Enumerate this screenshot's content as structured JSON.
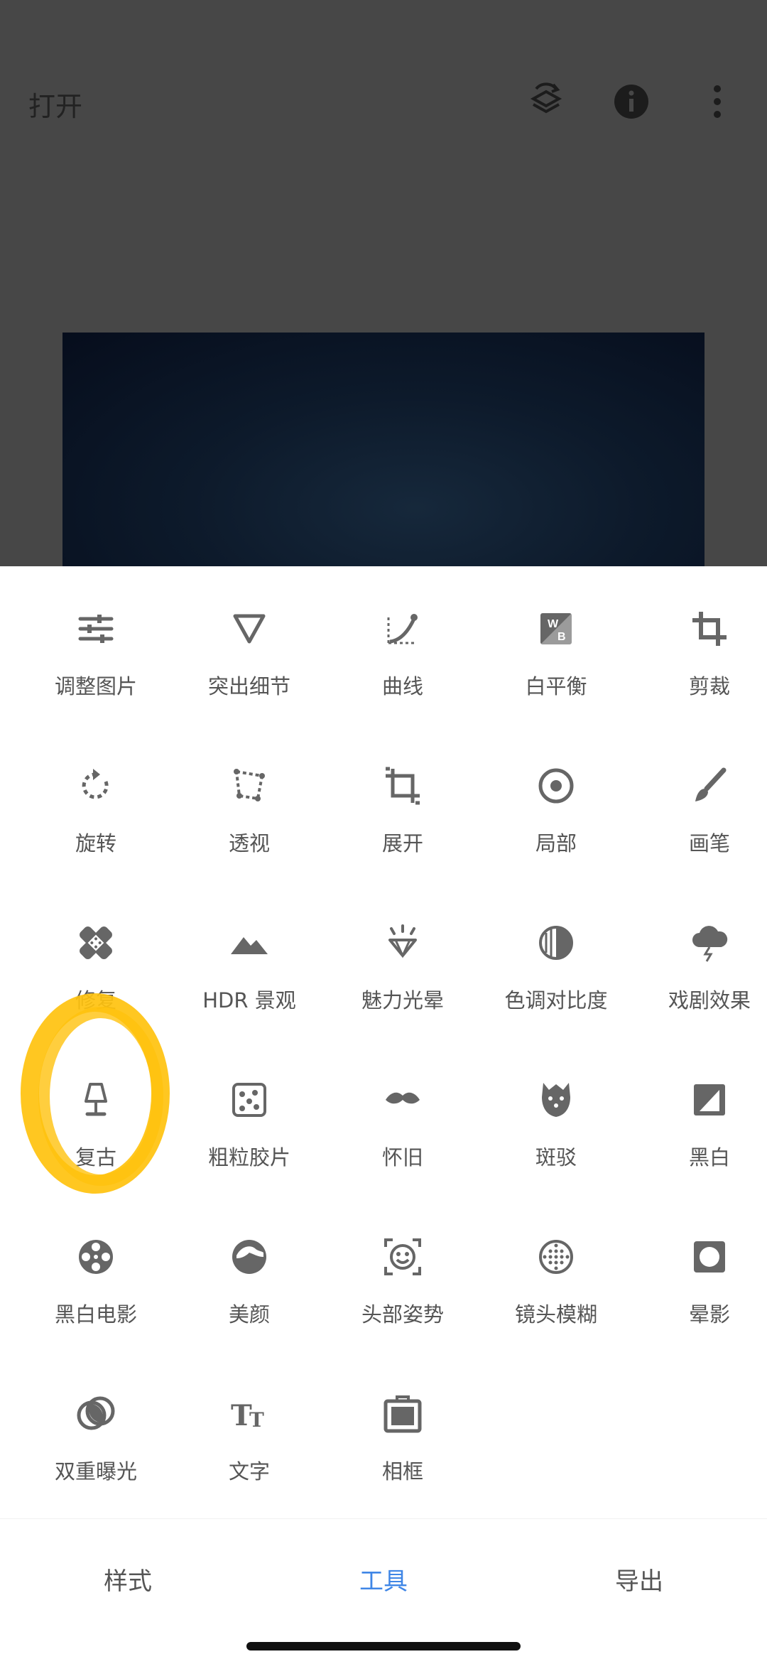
{
  "header": {
    "open_label": "打开",
    "icons": [
      "undo-stack-icon",
      "info-icon",
      "more-vert-icon"
    ]
  },
  "tools": [
    {
      "label": "调整图片",
      "icon": "tune-icon"
    },
    {
      "label": "突出细节",
      "icon": "details-icon"
    },
    {
      "label": "曲线",
      "icon": "curves-icon"
    },
    {
      "label": "白平衡",
      "icon": "white-balance-icon"
    },
    {
      "label": "剪裁",
      "icon": "crop-icon"
    },
    {
      "label": "旋转",
      "icon": "rotate-icon"
    },
    {
      "label": "透视",
      "icon": "perspective-icon"
    },
    {
      "label": "展开",
      "icon": "expand-icon"
    },
    {
      "label": "局部",
      "icon": "selective-icon"
    },
    {
      "label": "画笔",
      "icon": "brush-icon"
    },
    {
      "label": "修复",
      "icon": "healing-icon"
    },
    {
      "label": "HDR 景观",
      "icon": "hdr-icon"
    },
    {
      "label": "魅力光晕",
      "icon": "glamour-glow-icon"
    },
    {
      "label": "色调对比度",
      "icon": "tonal-contrast-icon"
    },
    {
      "label": "戏剧效果",
      "icon": "drama-icon"
    },
    {
      "label": "复古",
      "icon": "vintage-lamp-icon"
    },
    {
      "label": "粗粒胶片",
      "icon": "grainy-film-icon"
    },
    {
      "label": "怀旧",
      "icon": "mustache-icon"
    },
    {
      "label": "斑驳",
      "icon": "grunge-icon"
    },
    {
      "label": "黑白",
      "icon": "black-white-icon"
    },
    {
      "label": "黑白电影",
      "icon": "noir-film-icon"
    },
    {
      "label": "美颜",
      "icon": "face-icon"
    },
    {
      "label": "头部姿势",
      "icon": "head-pose-icon"
    },
    {
      "label": "镜头模糊",
      "icon": "lens-blur-icon"
    },
    {
      "label": "晕影",
      "icon": "vignette-icon"
    },
    {
      "label": "双重曝光",
      "icon": "double-exposure-icon"
    },
    {
      "label": "文字",
      "icon": "text-icon"
    },
    {
      "label": "相框",
      "icon": "frame-icon"
    }
  ],
  "bottom_nav": {
    "tabs": [
      {
        "label": "样式",
        "active": false
      },
      {
        "label": "工具",
        "active": true
      },
      {
        "label": "导出",
        "active": false
      }
    ]
  },
  "colors": {
    "accent": "#3f86e6",
    "icon": "#666666",
    "overlay": "#474747",
    "highlight_marker": "#ffc20e"
  }
}
